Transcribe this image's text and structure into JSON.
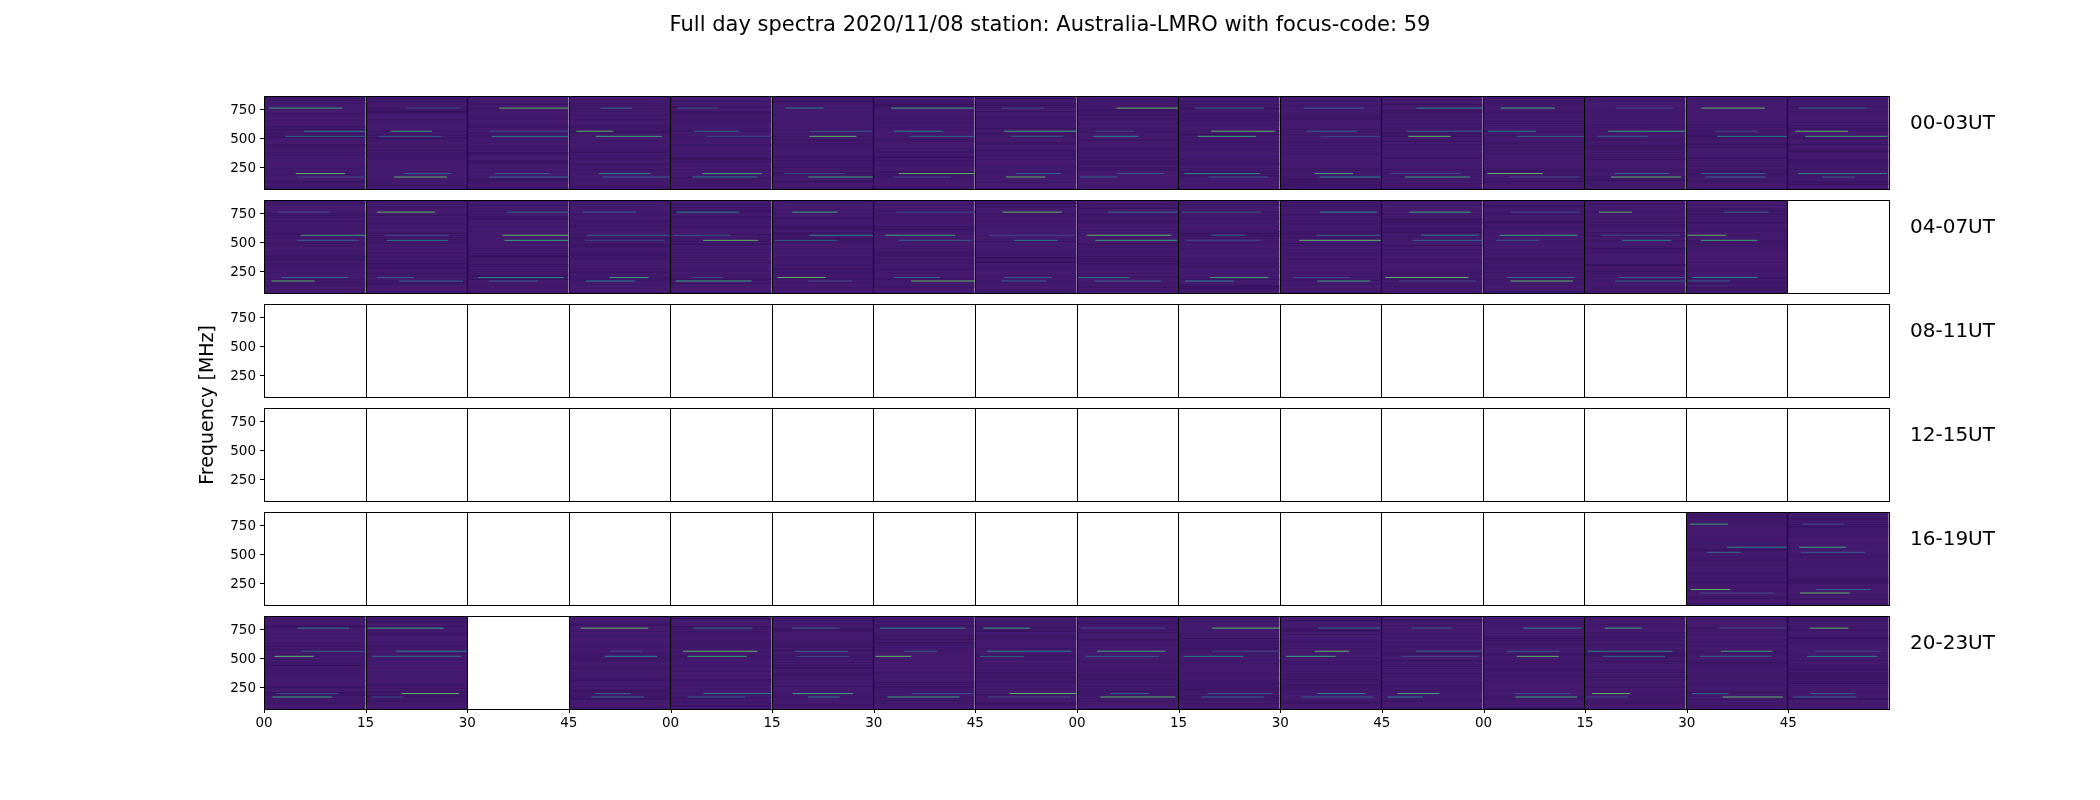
{
  "figure": {
    "title": "Full day spectra 2020/11/08 station: Australia-LMRO with focus-code: 59",
    "ylabel": "Frequency [MHz]",
    "rows": [
      {
        "label": "00-03UT",
        "yticks": [
          "750",
          "500",
          "250"
        ],
        "panels": [
          {
            "has_data": true
          },
          {
            "has_data": true
          },
          {
            "has_data": true
          },
          {
            "has_data": true
          },
          {
            "has_data": true
          },
          {
            "has_data": true
          },
          {
            "has_data": true
          },
          {
            "has_data": true
          },
          {
            "has_data": true
          },
          {
            "has_data": true
          },
          {
            "has_data": true
          },
          {
            "has_data": true
          },
          {
            "has_data": true
          },
          {
            "has_data": true
          },
          {
            "has_data": true
          },
          {
            "has_data": true
          }
        ]
      },
      {
        "label": "04-07UT",
        "yticks": [
          "750",
          "500",
          "250"
        ],
        "panels": [
          {
            "has_data": true
          },
          {
            "has_data": true
          },
          {
            "has_data": true
          },
          {
            "has_data": true
          },
          {
            "has_data": true
          },
          {
            "has_data": true
          },
          {
            "has_data": true
          },
          {
            "has_data": true
          },
          {
            "has_data": true
          },
          {
            "has_data": true
          },
          {
            "has_data": true
          },
          {
            "has_data": true
          },
          {
            "has_data": true
          },
          {
            "has_data": true
          },
          {
            "has_data": true
          },
          {
            "has_data": false
          }
        ]
      },
      {
        "label": "08-11UT",
        "yticks": [
          "750",
          "500",
          "250"
        ],
        "panels": [
          {
            "has_data": false
          },
          {
            "has_data": false
          },
          {
            "has_data": false
          },
          {
            "has_data": false
          },
          {
            "has_data": false
          },
          {
            "has_data": false
          },
          {
            "has_data": false
          },
          {
            "has_data": false
          },
          {
            "has_data": false
          },
          {
            "has_data": false
          },
          {
            "has_data": false
          },
          {
            "has_data": false
          },
          {
            "has_data": false
          },
          {
            "has_data": false
          },
          {
            "has_data": false
          },
          {
            "has_data": false
          }
        ]
      },
      {
        "label": "12-15UT",
        "yticks": [
          "750",
          "500",
          "250"
        ],
        "panels": [
          {
            "has_data": false
          },
          {
            "has_data": false
          },
          {
            "has_data": false
          },
          {
            "has_data": false
          },
          {
            "has_data": false
          },
          {
            "has_data": false
          },
          {
            "has_data": false
          },
          {
            "has_data": false
          },
          {
            "has_data": false
          },
          {
            "has_data": false
          },
          {
            "has_data": false
          },
          {
            "has_data": false
          },
          {
            "has_data": false
          },
          {
            "has_data": false
          },
          {
            "has_data": false
          },
          {
            "has_data": false
          }
        ]
      },
      {
        "label": "16-19UT",
        "yticks": [
          "750",
          "500",
          "250"
        ],
        "panels": [
          {
            "has_data": false
          },
          {
            "has_data": false
          },
          {
            "has_data": false
          },
          {
            "has_data": false
          },
          {
            "has_data": false
          },
          {
            "has_data": false
          },
          {
            "has_data": false
          },
          {
            "has_data": false
          },
          {
            "has_data": false
          },
          {
            "has_data": false
          },
          {
            "has_data": false
          },
          {
            "has_data": false
          },
          {
            "has_data": false
          },
          {
            "has_data": false
          },
          {
            "has_data": true
          },
          {
            "has_data": true
          }
        ]
      },
      {
        "label": "20-23UT",
        "yticks": [
          "750",
          "500",
          "250"
        ],
        "panels": [
          {
            "has_data": true
          },
          {
            "has_data": true
          },
          {
            "has_data": false
          },
          {
            "has_data": true
          },
          {
            "has_data": true
          },
          {
            "has_data": true
          },
          {
            "has_data": true
          },
          {
            "has_data": true
          },
          {
            "has_data": true
          },
          {
            "has_data": true
          },
          {
            "has_data": true
          },
          {
            "has_data": true
          },
          {
            "has_data": true
          },
          {
            "has_data": true
          },
          {
            "has_data": true
          },
          {
            "has_data": true
          }
        ]
      }
    ],
    "xticks": [
      "00",
      "15",
      "30",
      "45",
      "00",
      "15",
      "30",
      "45",
      "00",
      "15",
      "30",
      "45",
      "00",
      "15",
      "30",
      "45"
    ]
  }
}
